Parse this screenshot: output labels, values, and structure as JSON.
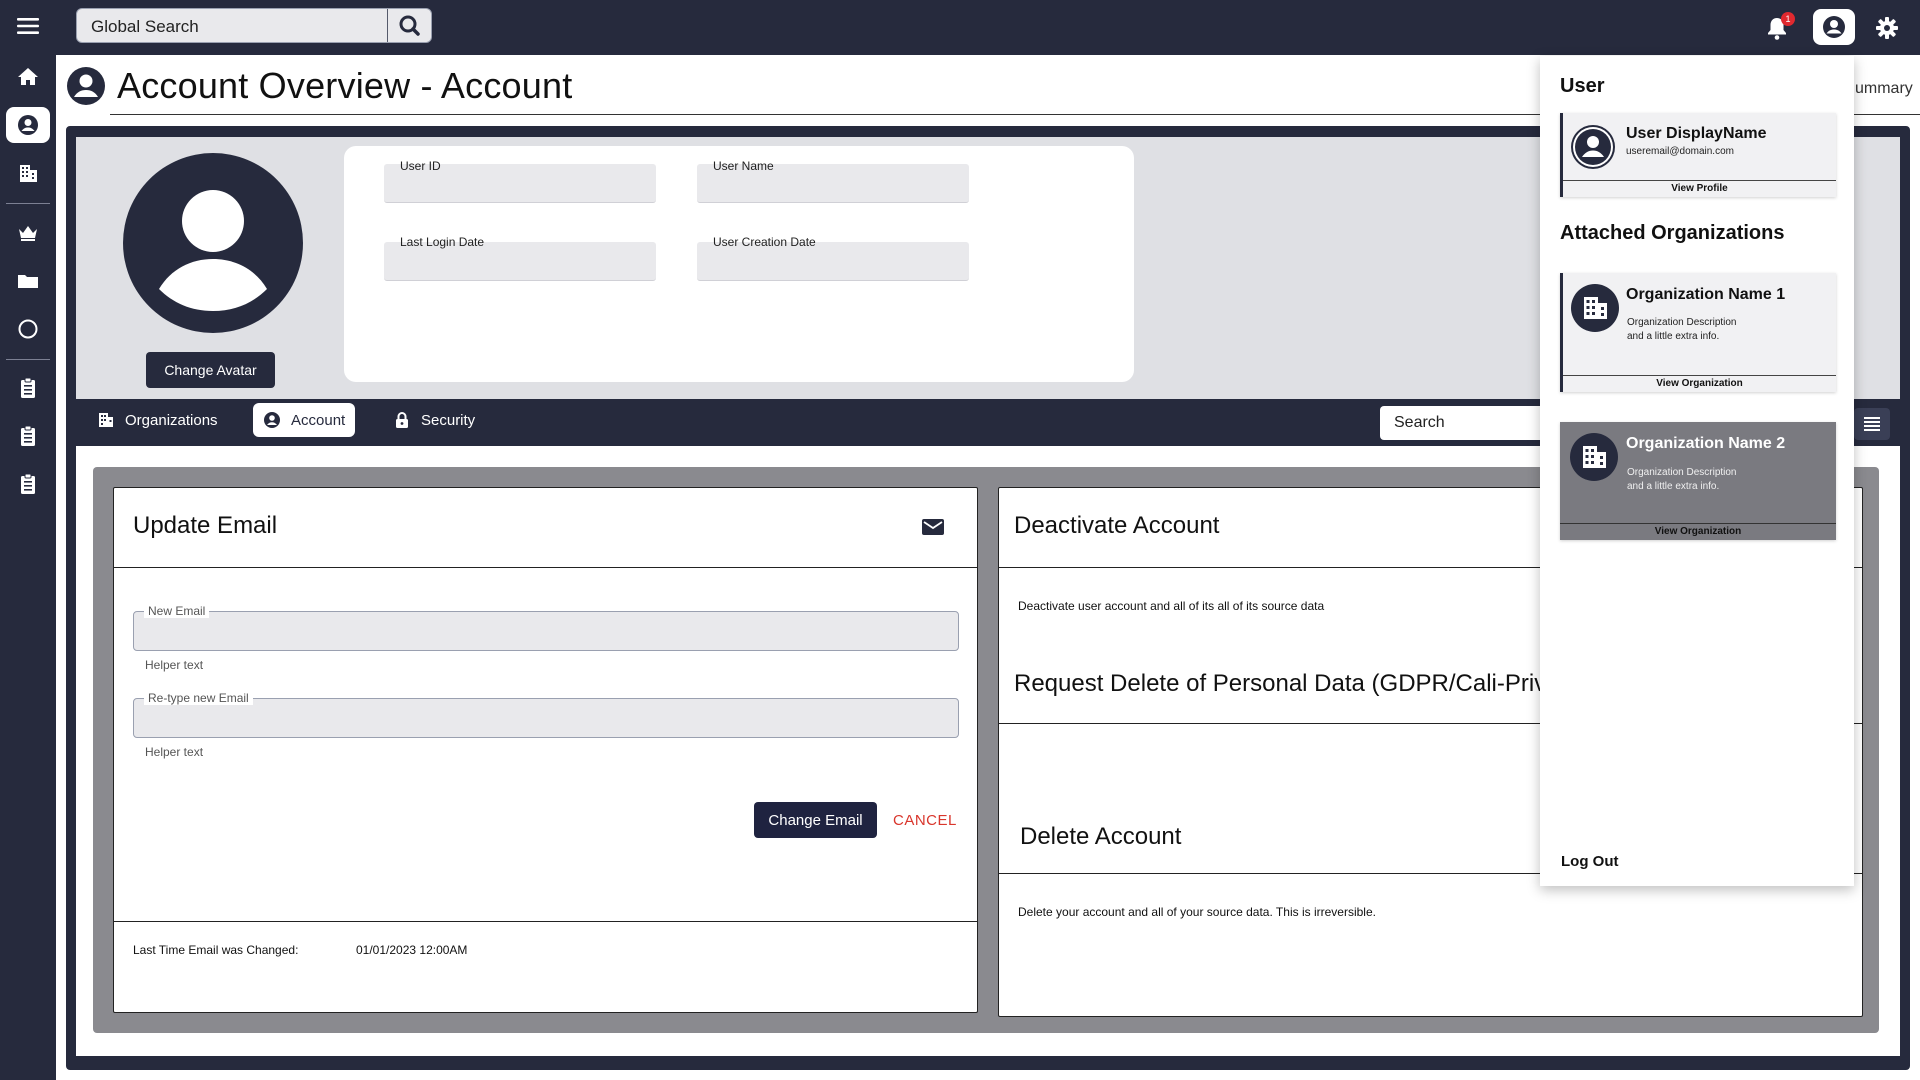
{
  "topbar": {
    "search_placeholder": "Global Search",
    "notification_count": "1"
  },
  "header": {
    "title": "Account Overview - Account",
    "summary_fragment": "ummary"
  },
  "profile": {
    "change_avatar": "Change Avatar",
    "fields": {
      "user_id": "User ID",
      "user_name": "User Name",
      "last_login": "Last Login Date",
      "creation_date": "User Creation Date"
    }
  },
  "tabs": [
    {
      "label": "Organizations",
      "icon": "building-icon"
    },
    {
      "label": "Account",
      "icon": "user-circle-icon"
    },
    {
      "label": "Security",
      "icon": "lock-icon"
    }
  ],
  "tab_search": "Search",
  "update_email": {
    "title": "Update Email",
    "new_email_label": "New Email",
    "retype_label": "Re-type new Email",
    "helper": "Helper text",
    "change_button": "Change Email",
    "cancel_button": "CANCEL",
    "last_changed_label": "Last Time Email was Changed:",
    "last_changed_value": "01/01/2023  12:00AM"
  },
  "deactivate": {
    "title": "Deactivate Account",
    "description": "Deactivate user account and all of its all of its source data",
    "gdpr_title": "Request Delete of Personal Data (GDPR/Cali-Priva",
    "delete_title": "Delete Account",
    "delete_description": "Delete your account and all of your source data. This is irreversible."
  },
  "user_panel": {
    "user_heading": "User",
    "display_name": "User DisplayName",
    "email": "useremail@domain.com",
    "view_profile": "View Profile",
    "orgs_heading": "Attached Organizations",
    "orgs": [
      {
        "name": "Organization Name 1",
        "desc1": "Organization Description",
        "desc2": "and a little extra info.",
        "action": "View Organization"
      },
      {
        "name": "Organization Name 2",
        "desc1": "Organization Description",
        "desc2": "and a little extra info.",
        "action": "View Organization"
      }
    ],
    "logout": "Log Out"
  },
  "colors": {
    "navy": "#262a3d",
    "cancel_red": "#d9362c",
    "badge_red": "#e0292f"
  }
}
